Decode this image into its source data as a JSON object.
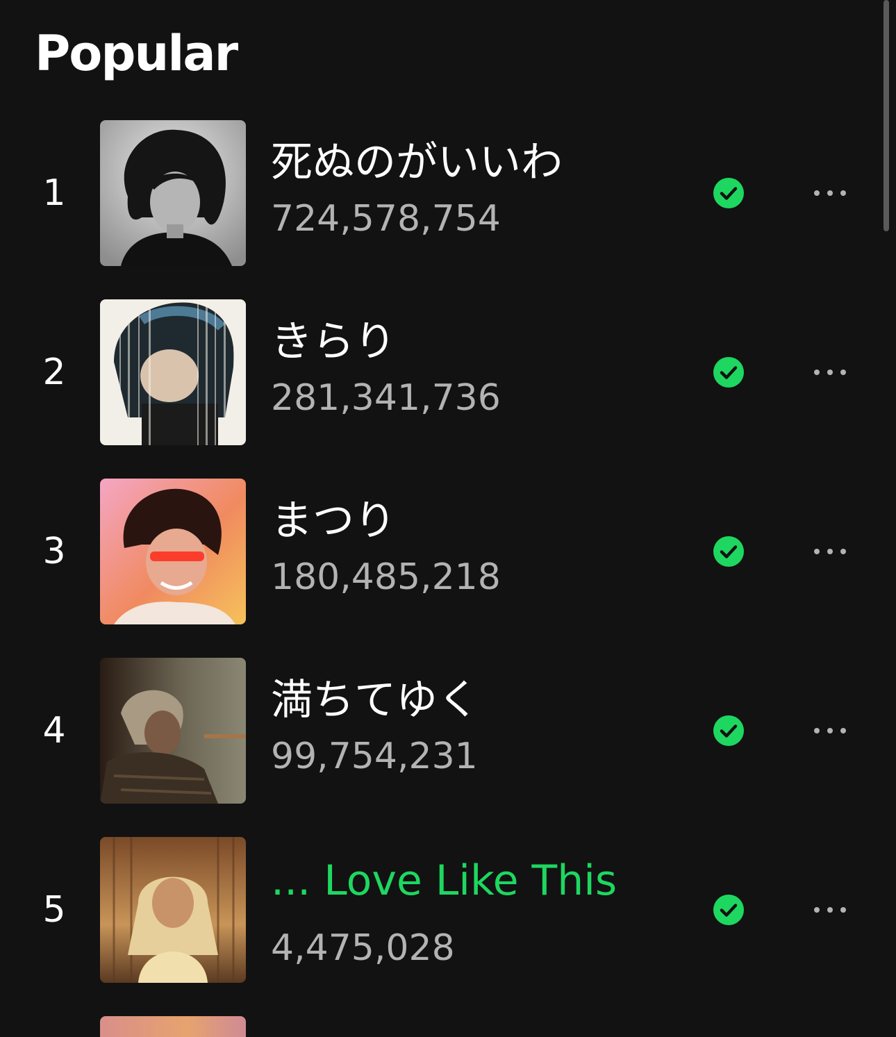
{
  "section": {
    "title": "Popular"
  },
  "tracks": [
    {
      "rank": "1",
      "title": "死ぬのがいいわ",
      "plays": "724,578,754",
      "playing": false,
      "downloaded": true,
      "cover": "black-and-white portrait of curly-haired man"
    },
    {
      "rank": "2",
      "title": "きらり",
      "plays": "281,341,736",
      "playing": false,
      "downloaded": true,
      "cover": "man in helmet with striped glitch effect"
    },
    {
      "rank": "3",
      "title": "まつり",
      "plays": "180,485,218",
      "playing": false,
      "downloaded": true,
      "cover": "smiling man on orange-pink gradient"
    },
    {
      "rank": "4",
      "title": "満ちてゆく",
      "plays": "99,754,231",
      "playing": false,
      "downloaded": true,
      "cover": "man in dark brown interior"
    },
    {
      "rank": "5",
      "title": "... Love Like This",
      "plays": "4,475,028",
      "playing": true,
      "downloaded": true,
      "cover": "man with towel over head in warm light"
    }
  ],
  "icons": {
    "downloaded": "check-circle-icon",
    "more": "more-options-icon"
  },
  "colors": {
    "background": "#121212",
    "accent": "#1ed760",
    "secondary_text": "#b3b3b3"
  }
}
